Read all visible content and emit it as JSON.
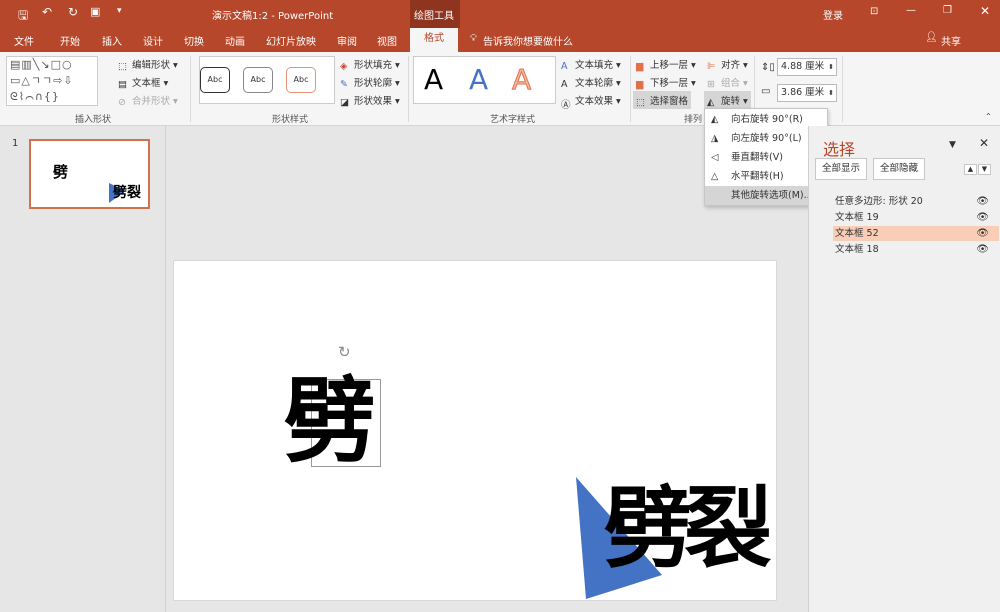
{
  "titlebar": {
    "doc_title": "演示文稿1:2 - PowerPoint",
    "context_tab": "绘图工具",
    "login": "登录",
    "qat": [
      "save-icon",
      "undo-icon",
      "redo-icon",
      "present-icon",
      "customize-icon"
    ]
  },
  "tabs": [
    "文件",
    "开始",
    "插入",
    "设计",
    "切换",
    "动画",
    "幻灯片放映",
    "审阅",
    "视图",
    "格式"
  ],
  "active_tab": "格式",
  "tell_me": "告诉我你想要做什么",
  "share": "共享",
  "ribbon": {
    "insert_shapes": {
      "label": "插入形状",
      "edit_shape": "编辑形状",
      "text_box": "文本框",
      "merge_shapes": "合并形状"
    },
    "shape_styles": {
      "label": "形状样式",
      "samples": [
        "Abc",
        "Abc",
        "Abc"
      ],
      "fill": "形状填充",
      "outline": "形状轮廓",
      "effects": "形状效果"
    },
    "wordart": {
      "label": "艺术字样式",
      "samples": [
        "A",
        "A",
        "A"
      ],
      "text_fill": "文本填充",
      "text_outline": "文本轮廓",
      "text_effects": "文本效果"
    },
    "arrange": {
      "label": "排列",
      "bring_forward": "上移一层",
      "send_backward": "下移一层",
      "selection_pane": "选择窗格",
      "align": "对齐",
      "group": "组合",
      "rotate": "旋转"
    },
    "size": {
      "height": "4.88 厘米",
      "width": "3.86 厘米"
    }
  },
  "rotate_menu": [
    "向右旋转 90°(R)",
    "向左旋转 90°(L)",
    "垂直翻转(V)",
    "水平翻转(H)",
    "其他旋转选项(M)..."
  ],
  "thumbnail": {
    "number": "1"
  },
  "slide": {
    "text1": "劈",
    "text2": "劈裂"
  },
  "selection_pane": {
    "title": "选择",
    "show_all": "全部显示",
    "hide_all": "全部隐藏",
    "items": [
      "任意多边形: 形状 20",
      "文本框 19",
      "文本框 52",
      "文本框 18"
    ],
    "selected_index": 2
  },
  "colors": {
    "brand": "#b7472a",
    "selected_row": "#f9cdb6",
    "shape_blue": "#4472c4"
  }
}
